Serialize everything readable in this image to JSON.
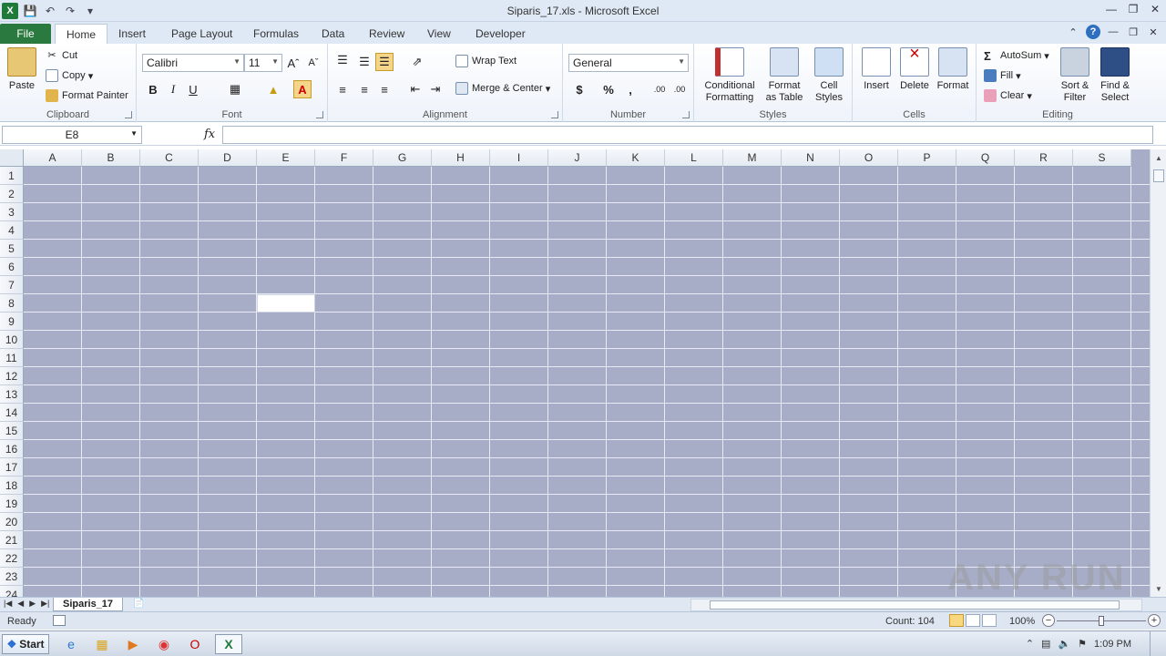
{
  "window": {
    "title": "Siparis_17.xls  -  Microsoft Excel"
  },
  "tabs": [
    "File",
    "Home",
    "Insert",
    "Page Layout",
    "Formulas",
    "Data",
    "Review",
    "View",
    "Developer"
  ],
  "ribbon": {
    "clipboard": {
      "label": "Clipboard",
      "paste": "Paste",
      "cut": "Cut",
      "copy": "Copy",
      "format_painter": "Format Painter"
    },
    "font": {
      "label": "Font",
      "name": "Calibri",
      "size": "11",
      "bold": "B",
      "italic": "I",
      "underline": "U"
    },
    "alignment": {
      "label": "Alignment",
      "wrap_text": "Wrap Text",
      "merge_center": "Merge & Center"
    },
    "number": {
      "label": "Number",
      "format": "General",
      "currency": "$",
      "percent": "%",
      "comma": ",",
      "inc_decimal": ".00",
      "dec_decimal": ".00"
    },
    "styles": {
      "label": "Styles",
      "conditional": "Conditional",
      "conditional2": "Formatting",
      "format_table": "Format",
      "format_table2": "as Table",
      "cell_styles": "Cell",
      "cell_styles2": "Styles"
    },
    "cells": {
      "label": "Cells",
      "insert": "Insert",
      "delete": "Delete",
      "format": "Format"
    },
    "editing": {
      "label": "Editing",
      "autosum": "AutoSum",
      "fill": "Fill",
      "clear": "Clear",
      "sort_filter": "Sort &",
      "sort_filter2": "Filter",
      "find_select": "Find &",
      "find_select2": "Select"
    }
  },
  "formula_bar": {
    "name_box": "E8",
    "fx": "fx",
    "value": ""
  },
  "columns": [
    "A",
    "B",
    "C",
    "D",
    "E",
    "F",
    "G",
    "H",
    "I",
    "J",
    "K",
    "L",
    "M",
    "N",
    "O",
    "P",
    "Q",
    "R",
    "S"
  ],
  "rows": [
    "1",
    "2",
    "3",
    "4",
    "5",
    "6",
    "7",
    "8",
    "9",
    "10",
    "11",
    "12",
    "13",
    "14",
    "15",
    "16",
    "17",
    "18",
    "19",
    "20",
    "21",
    "22",
    "23",
    "24"
  ],
  "sheet": {
    "tab": "Siparis_17"
  },
  "status": {
    "ready": "Ready",
    "count": "Count: 104",
    "zoom": "100%"
  },
  "taskbar": {
    "start": "Start",
    "time": "1:09 PM"
  },
  "watermark": "ANY RUN",
  "colors": {
    "grid_fill": "#a8adc7",
    "file_tab": "#2a7a3f",
    "selected_cell": "#ffffff"
  }
}
